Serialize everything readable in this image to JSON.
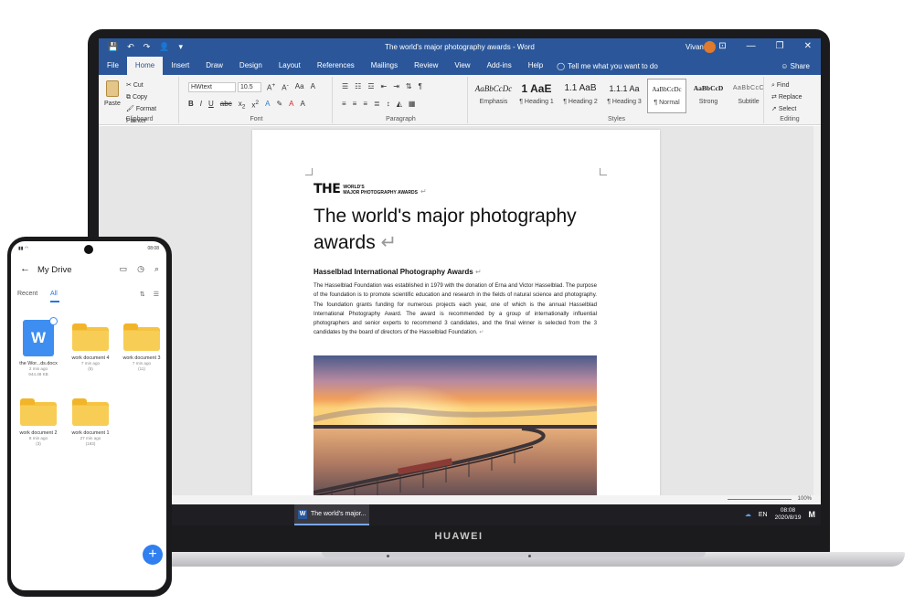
{
  "laptop": {
    "brand": "HUAWEI",
    "word": {
      "window_title": "The world's major photography awards - Word",
      "user": "Vivan",
      "qat": [
        "💾",
        "↶",
        "↷",
        "👤",
        "▾"
      ],
      "window_buttons": [
        "⊡",
        "—",
        "❐",
        "✕"
      ],
      "tabs": [
        "File",
        "Home",
        "Insert",
        "Draw",
        "Design",
        "Layout",
        "References",
        "Mailings",
        "Review",
        "View",
        "Add-ins",
        "Help"
      ],
      "tell_me": "Tell me what you want to do",
      "share": "Share",
      "ribbon": {
        "clipboard": {
          "paste": "Paste",
          "cut": "Cut",
          "copy": "Copy",
          "format_painter": "Format Painter",
          "label": "Clipboard"
        },
        "font": {
          "family": "HWtext",
          "size": "10.5",
          "label": "Font"
        },
        "paragraph": {
          "label": "Paragraph"
        },
        "styles": {
          "label": "Styles",
          "items": [
            {
              "preview": "AaBbCcDc",
              "name": "Emphasis"
            },
            {
              "preview": "1",
              "name": "¶ Heading 1"
            },
            {
              "preview": "AaE",
              "name": ""
            },
            {
              "preview": "1.1",
              "name": "¶ Heading 2"
            },
            {
              "preview": "AaB",
              "name": ""
            },
            {
              "preview": "1.1.1",
              "name": "¶ Heading 3"
            },
            {
              "preview": "Aa",
              "name": ""
            },
            {
              "preview": "AaBbCcDc",
              "name": "¶ Normal"
            },
            {
              "preview": "AaBbCcD",
              "name": "Strong"
            },
            {
              "preview": "AaBbCcC",
              "name": "Subtitle"
            }
          ]
        },
        "editing": {
          "find": "Find",
          "replace": "Replace",
          "select": "Select",
          "label": "Editing"
        }
      },
      "document": {
        "logo_the": "THE",
        "logo_small_1": "WORLD'S",
        "logo_small_2": "MAJOR PHOTOGRAPHY AWARDS",
        "title": "The world's major photography awards",
        "subtitle": "Hasselblad International Photography Awards",
        "body": "The Hasselblad Foundation was established in 1979 with the donation of Erna and Victor Hasselblad. The purpose of the foundation is to promote scientific education and research in the fields of natural science and photography. The foundation grants funding for numerous projects each year, one of which is the annual Hasselblad International Photography Award. The award is recommended by a group of internationally influential photographers and senior experts to recommend 3 candidates, and the final winner is selected from the 3 candidates by the board of directors of the Hasselblad Foundation."
      },
      "zoom": "100%"
    },
    "taskbar": {
      "item": "The world's major...",
      "lang": "EN",
      "time": "08:08",
      "date": "2020/8/19"
    }
  },
  "phone": {
    "status_time": "08:08",
    "title": "My Drive",
    "tabs": {
      "recent": "Recent",
      "all": "All"
    },
    "files": [
      {
        "name": "the Wor...ds.docx",
        "meta1": "2 min ago",
        "meta2": "944.48 KB",
        "type": "docx"
      },
      {
        "name": "work document 4",
        "meta1": "7 min ago",
        "meta2": "(5)",
        "type": "folder"
      },
      {
        "name": "work document 3",
        "meta1": "7 min ago",
        "meta2": "(11)",
        "type": "folder"
      },
      {
        "name": "work document 2",
        "meta1": "8 min ago",
        "meta2": "(3)",
        "type": "folder"
      },
      {
        "name": "work document 1",
        "meta1": "27 min ago",
        "meta2": "(183)",
        "type": "folder"
      }
    ]
  },
  "colors": {
    "word_blue": "#2b579a",
    "drive_blue": "#2f7ff0",
    "folder_yellow": "#f6c343"
  }
}
